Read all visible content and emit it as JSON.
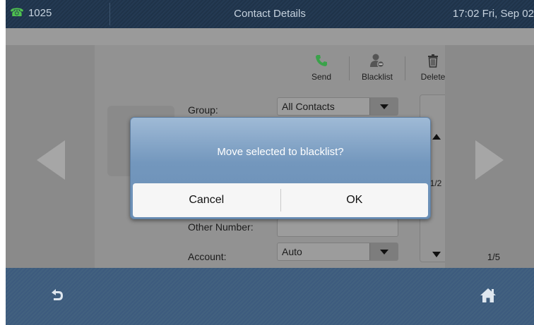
{
  "status_bar": {
    "line": "1025",
    "line_icon": "phone-line-registered-icon",
    "title": "Contact Details",
    "clock": "17:02 Fri, Sep 02"
  },
  "toolbar": {
    "send_label": "Send",
    "send_icon": "phone-handset-icon",
    "blacklist_label": "Blacklist",
    "blacklist_icon": "user-block-icon",
    "delete_label": "Delete",
    "delete_icon": "trash-icon"
  },
  "form": {
    "group_label": "Group:",
    "group_value": "All Contacts",
    "other_number_label": "Other Number:",
    "other_number_value": "",
    "account_label": "Account:",
    "account_value": "Auto"
  },
  "field_page": "1/2",
  "record_page": "1/5",
  "dialog": {
    "message": "Move selected to blacklist?",
    "cancel_label": "Cancel",
    "ok_label": "OK"
  },
  "softkeys": {
    "back_icon": "back-arrow-icon",
    "home_icon": "home-icon"
  },
  "colors": {
    "accent_green": "#4fc24f",
    "dialog_blue": "#7397bd",
    "bar_blue": "#3c5a7d"
  }
}
